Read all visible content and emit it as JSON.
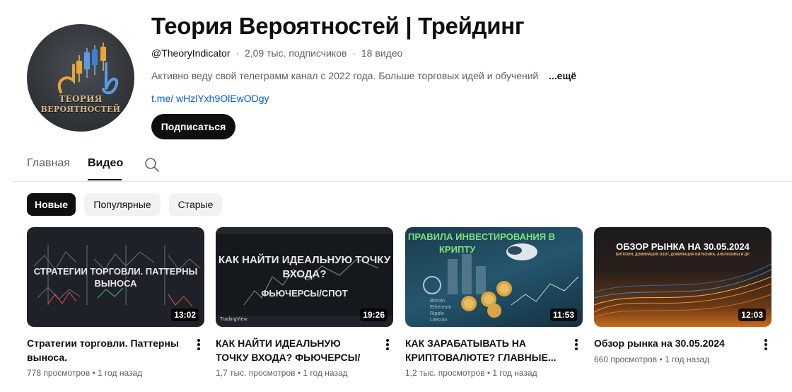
{
  "channel": {
    "avatar_text_line1": "ТЕОРИЯ",
    "avatar_text_line2": "ВЕРОЯТНОСТЕЙ",
    "title": "Теория Вероятностей | Трейдинг",
    "handle": "@TheoryIndicator",
    "subscribers": "2,09 тыс. подписчиков",
    "video_count": "18 видео",
    "separator": "·",
    "description": "Активно веду свой телеграмм канал с 2022 года. Больше торговых идей и обучений",
    "more_label": "...ещё",
    "link": "t.me/ wHzlYxh9OlEwODgy",
    "subscribe_label": "Подписаться"
  },
  "tabs": [
    {
      "label": "Главная",
      "active": false
    },
    {
      "label": "Видео",
      "active": true
    }
  ],
  "search_icon": "search-icon",
  "chips": [
    {
      "label": "Новые",
      "active": true
    },
    {
      "label": "Популярные",
      "active": false
    },
    {
      "label": "Старые",
      "active": false
    }
  ],
  "videos": [
    {
      "title": "Стратегии торговли. Паттерны выноса.",
      "thumb_text_1": "СТРАТЕГИИ ТОРГОВЛИ. ПАТТЕРНЫ",
      "thumb_text_2": "ВЫНОСА",
      "duration": "13:02",
      "views": "778 просмотров",
      "age": "1 год назад"
    },
    {
      "title": "КАК НАЙТИ ИДЕАЛЬНУЮ ТОЧКУ ВХОДА? ФЬЮЧЕРСЫ/СПОТ.",
      "thumb_text_1": "КАК НАЙТИ ИДЕАЛЬНУЮ ТОЧКУ",
      "thumb_text_2": "ВХОДА?",
      "thumb_text_3": "ФЬЮЧЕРСЫ/СПОТ",
      "thumb_brand": "TradingView",
      "duration": "19:26",
      "views": "1,7 тыс. просмотров",
      "age": "1 год назад"
    },
    {
      "title": "КАК ЗАРАБАТЫВАТЬ НА КРИПТОВАЛЮТЕ? ГЛАВНЫЕ...",
      "thumb_text_1": "ПРАВИЛА ИНВЕСТИРОВАНИЯ В",
      "thumb_text_2": "КРИПТУ",
      "thumb_coins": [
        "Bitcoin",
        "Ethereum",
        "Ripple",
        "Litecoin"
      ],
      "duration": "11:53",
      "views": "1,2 тыс. просмотров",
      "age": "1 год назад"
    },
    {
      "title": "Обзор рынка на 30.05.2024",
      "thumb_text_1": "ОБЗОР РЫНКА НА 30.05.2024",
      "thumb_text_2": "БИТКОИН, ДОМИНАЦИЯ USDT, ДОМИНАЦИЯ БИТКОИНА, АЛЬТКОИНЫ И ДР.",
      "duration": "12:03",
      "views": "660 просмотров",
      "age": "1 год назад"
    }
  ],
  "colors": {
    "accent": "#0f0f0f",
    "link": "#065fd4",
    "secondary_text": "#606060",
    "chip_bg": "#f2f2f2"
  }
}
